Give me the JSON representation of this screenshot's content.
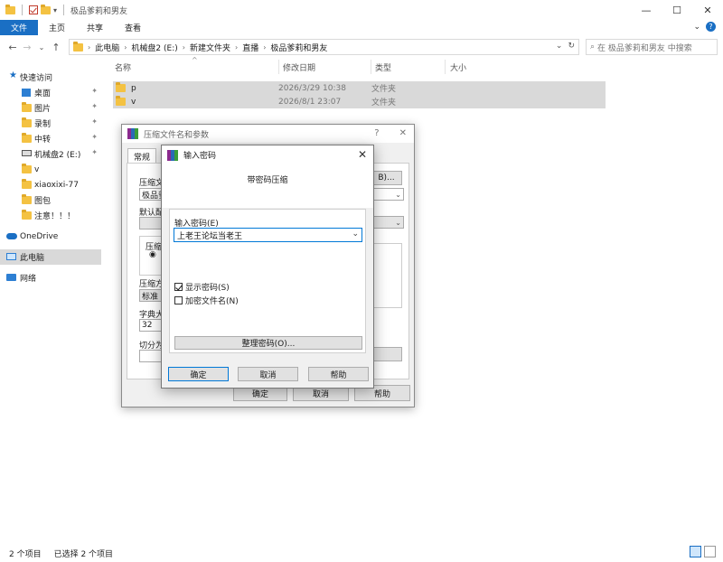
{
  "window": {
    "title": "极品爹莉和男友",
    "ctrl_min": "—",
    "ctrl_max": "☐",
    "ctrl_close": "✕"
  },
  "ribbon": {
    "tabs": [
      "文件",
      "主页",
      "共享",
      "查看"
    ],
    "expand_glyph": "⌄",
    "help_glyph": "?"
  },
  "address": {
    "back": "←",
    "forward": "→",
    "recent": "⌄",
    "up": "↑",
    "crumbs": [
      "此电脑",
      "机械盘2 (E:)",
      "新建文件夹",
      "直播",
      "极品爹莉和男友"
    ],
    "sep": "›",
    "dropdown": "⌄",
    "refresh": "↻",
    "search_placeholder": "在 极品爹莉和男友 中搜索",
    "search_glyph": "⌕"
  },
  "sidebar": {
    "items": [
      {
        "label": "快速访问",
        "type": "quick"
      },
      {
        "label": "桌面",
        "type": "desktop",
        "pinned": true
      },
      {
        "label": "图片",
        "type": "folder",
        "pinned": true
      },
      {
        "label": "录制",
        "type": "folder",
        "pinned": true
      },
      {
        "label": "中转",
        "type": "folder",
        "pinned": true
      },
      {
        "label": "机械盘2 (E:)",
        "type": "drive",
        "pinned": true
      },
      {
        "label": "v",
        "type": "folder"
      },
      {
        "label": "xiaoxixi-77",
        "type": "folder"
      },
      {
        "label": "图包",
        "type": "folder"
      },
      {
        "label": "注意！！！",
        "type": "folder"
      },
      {
        "label": "OneDrive",
        "type": "cloud"
      },
      {
        "label": "此电脑",
        "type": "pc"
      },
      {
        "label": "网络",
        "type": "net"
      }
    ],
    "pin_glyph": "📌"
  },
  "fileview": {
    "columns": [
      "名称",
      "修改日期",
      "类型",
      "大小"
    ],
    "sort_glyph": "^",
    "rows": [
      {
        "name": "p",
        "date": "2026/3/29 10:38",
        "type": "文件夹"
      },
      {
        "name": "v",
        "date": "2026/8/1 23:07",
        "type": "文件夹"
      }
    ]
  },
  "status": {
    "count": "2 个项目",
    "selected": "已选择 2 个项目"
  },
  "rar_dialog": {
    "title": "压缩文件名和参数",
    "help": "?",
    "close": "✕",
    "tab_general": "常规",
    "lbl_archive": "压缩文",
    "archive_value": "极品爹",
    "browse": "B)...",
    "lbl_default": "默认配",
    "lbl_format": "压缩",
    "radio": "◉",
    "lbl_method": "压缩方",
    "method_value": "标准",
    "lbl_dict": "字典大",
    "dict_value": "32",
    "lbl_split": "切分为",
    "ok": "确定",
    "cancel": "取消",
    "help_btn": "帮助"
  },
  "password_dialog": {
    "title": "输入密码",
    "close": "✕",
    "heading": "带密码压缩",
    "password_label": "输入密码(E)",
    "password_value": "上老王论坛当老王",
    "dropdown_glyph": "⌄",
    "show_password": "显示密码(S)",
    "show_password_checked": true,
    "encrypt_names": "加密文件名(N)",
    "encrypt_names_checked": false,
    "organize": "整理密码(O)...",
    "ok": "确定",
    "cancel": "取消",
    "help": "帮助"
  }
}
